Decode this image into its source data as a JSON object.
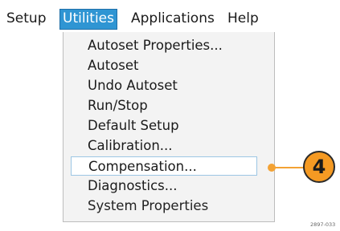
{
  "menubar": {
    "items": [
      "Setup",
      "Utilities",
      "Applications",
      "Help"
    ]
  },
  "dropdown": {
    "items": [
      "Autoset Properties...",
      "Autoset",
      "Undo Autoset",
      "Run/Stop",
      "Default Setup",
      "Calibration...",
      "Compensation...",
      "Diagnostics...",
      "System Properties"
    ],
    "highlighted": "Compensation..."
  },
  "callout": {
    "number": "4"
  },
  "figure_code": "2897-033",
  "colors": {
    "active_menu": "#2f95d3",
    "callout": "#f59a23",
    "dropdown_bg": "#f3f3f3"
  }
}
